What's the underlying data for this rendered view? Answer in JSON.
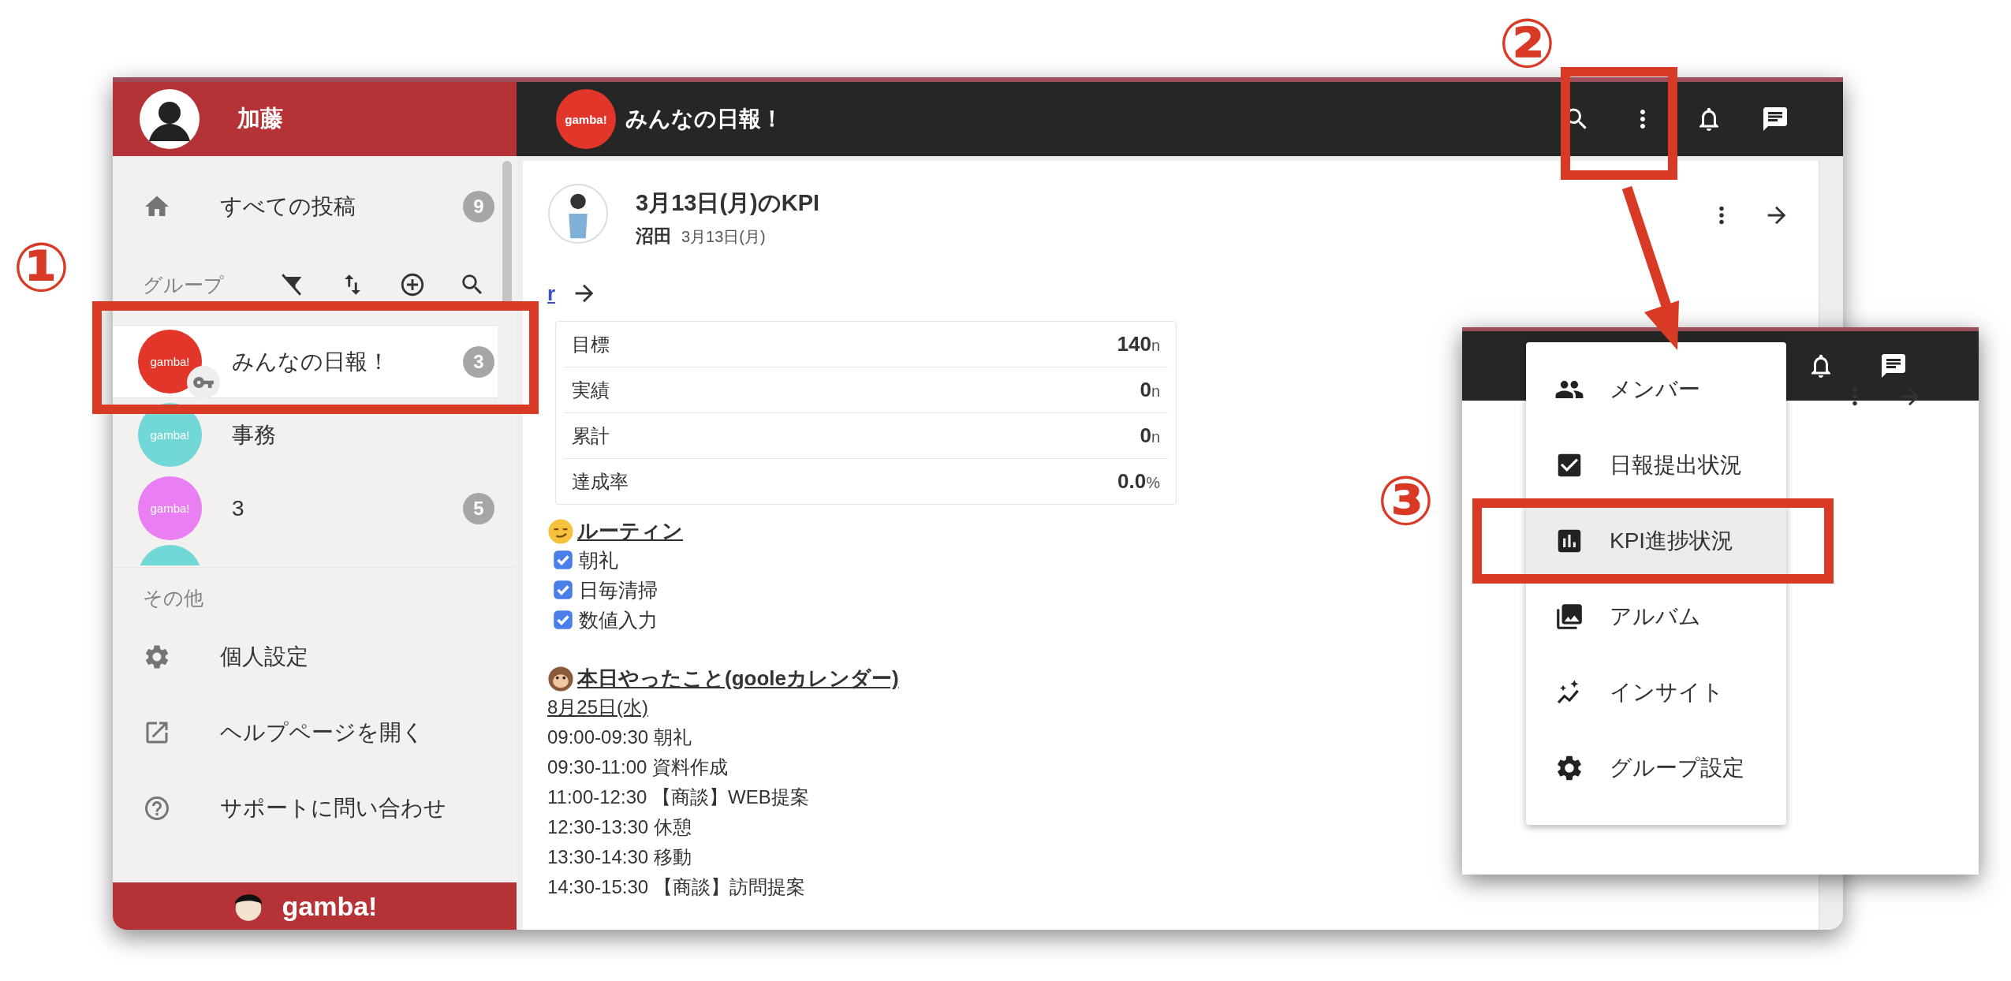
{
  "sidebar": {
    "user_name": "加藤",
    "top_items": [
      {
        "kind": "home",
        "label": "すべての投稿",
        "badge": "9"
      }
    ],
    "groups_label": "グループ",
    "groups": [
      {
        "name": "みんなの日報！",
        "avatar_text": "gamba!",
        "color": "#e2362b",
        "badge": "3",
        "selected": true,
        "key_badge": true
      },
      {
        "name": "事務",
        "avatar_text": "gamba!",
        "color": "#72d7d7",
        "selected": false,
        "key_badge": false
      },
      {
        "name": "3",
        "avatar_text": "gamba!",
        "color": "#e97ff2",
        "badge": "5",
        "selected": false,
        "key_badge": false
      },
      {
        "color": "#72d7d7"
      }
    ],
    "other_label": "その他",
    "other_items": [
      {
        "kind": "settings",
        "label": "個人設定"
      },
      {
        "kind": "open",
        "label": "ヘルプページを開く"
      },
      {
        "kind": "help",
        "label": "サポートに問い合わせ"
      }
    ],
    "footer_logo": "gamba!"
  },
  "topbar": {
    "logo_text": "gamba!",
    "group_name": "みんなの日報！"
  },
  "post": {
    "title": "3月13日(月)のKPI",
    "author": "沼田",
    "date": "3月13日(月)",
    "link_text": "r",
    "kpi_rows": [
      {
        "label": "目標",
        "value": "140",
        "unit": "n"
      },
      {
        "label": "実績",
        "value": "0",
        "unit": "n"
      },
      {
        "label": "累計",
        "value": "0",
        "unit": "n"
      },
      {
        "label": "達成率",
        "value": "0.0",
        "unit": "%"
      }
    ],
    "routine": {
      "heading": "ルーティン",
      "items": [
        {
          "label": "朝礼",
          "checked": true
        },
        {
          "label": "日毎清掃",
          "checked": true
        },
        {
          "label": "数値入力",
          "checked": true
        }
      ]
    },
    "calendar": {
      "heading": "本日やったこと(gooleカレンダー)",
      "date": "8月25日(水)",
      "entries": [
        "09:00-09:30 朝礼",
        "09:30-11:00 資料作成",
        "11:00-12:30 【商談】WEB提案",
        "12:30-13:30 休憩",
        "13:30-14:30 移動",
        "14:30-15:30 【商談】訪問提案"
      ]
    }
  },
  "menu": {
    "items": [
      {
        "kind": "people",
        "label": "メンバー",
        "selected": false
      },
      {
        "kind": "check",
        "label": "日報提出状況",
        "selected": false
      },
      {
        "kind": "chart",
        "label": "KPI進捗状況",
        "selected": true
      },
      {
        "kind": "photos",
        "label": "アルバム",
        "selected": false
      },
      {
        "kind": "insights",
        "label": "インサイト",
        "selected": false
      },
      {
        "kind": "settings",
        "label": "グループ設定",
        "selected": false
      }
    ]
  },
  "annotations": [
    {
      "label": "①"
    },
    {
      "label": "②"
    },
    {
      "label": "③"
    }
  ]
}
